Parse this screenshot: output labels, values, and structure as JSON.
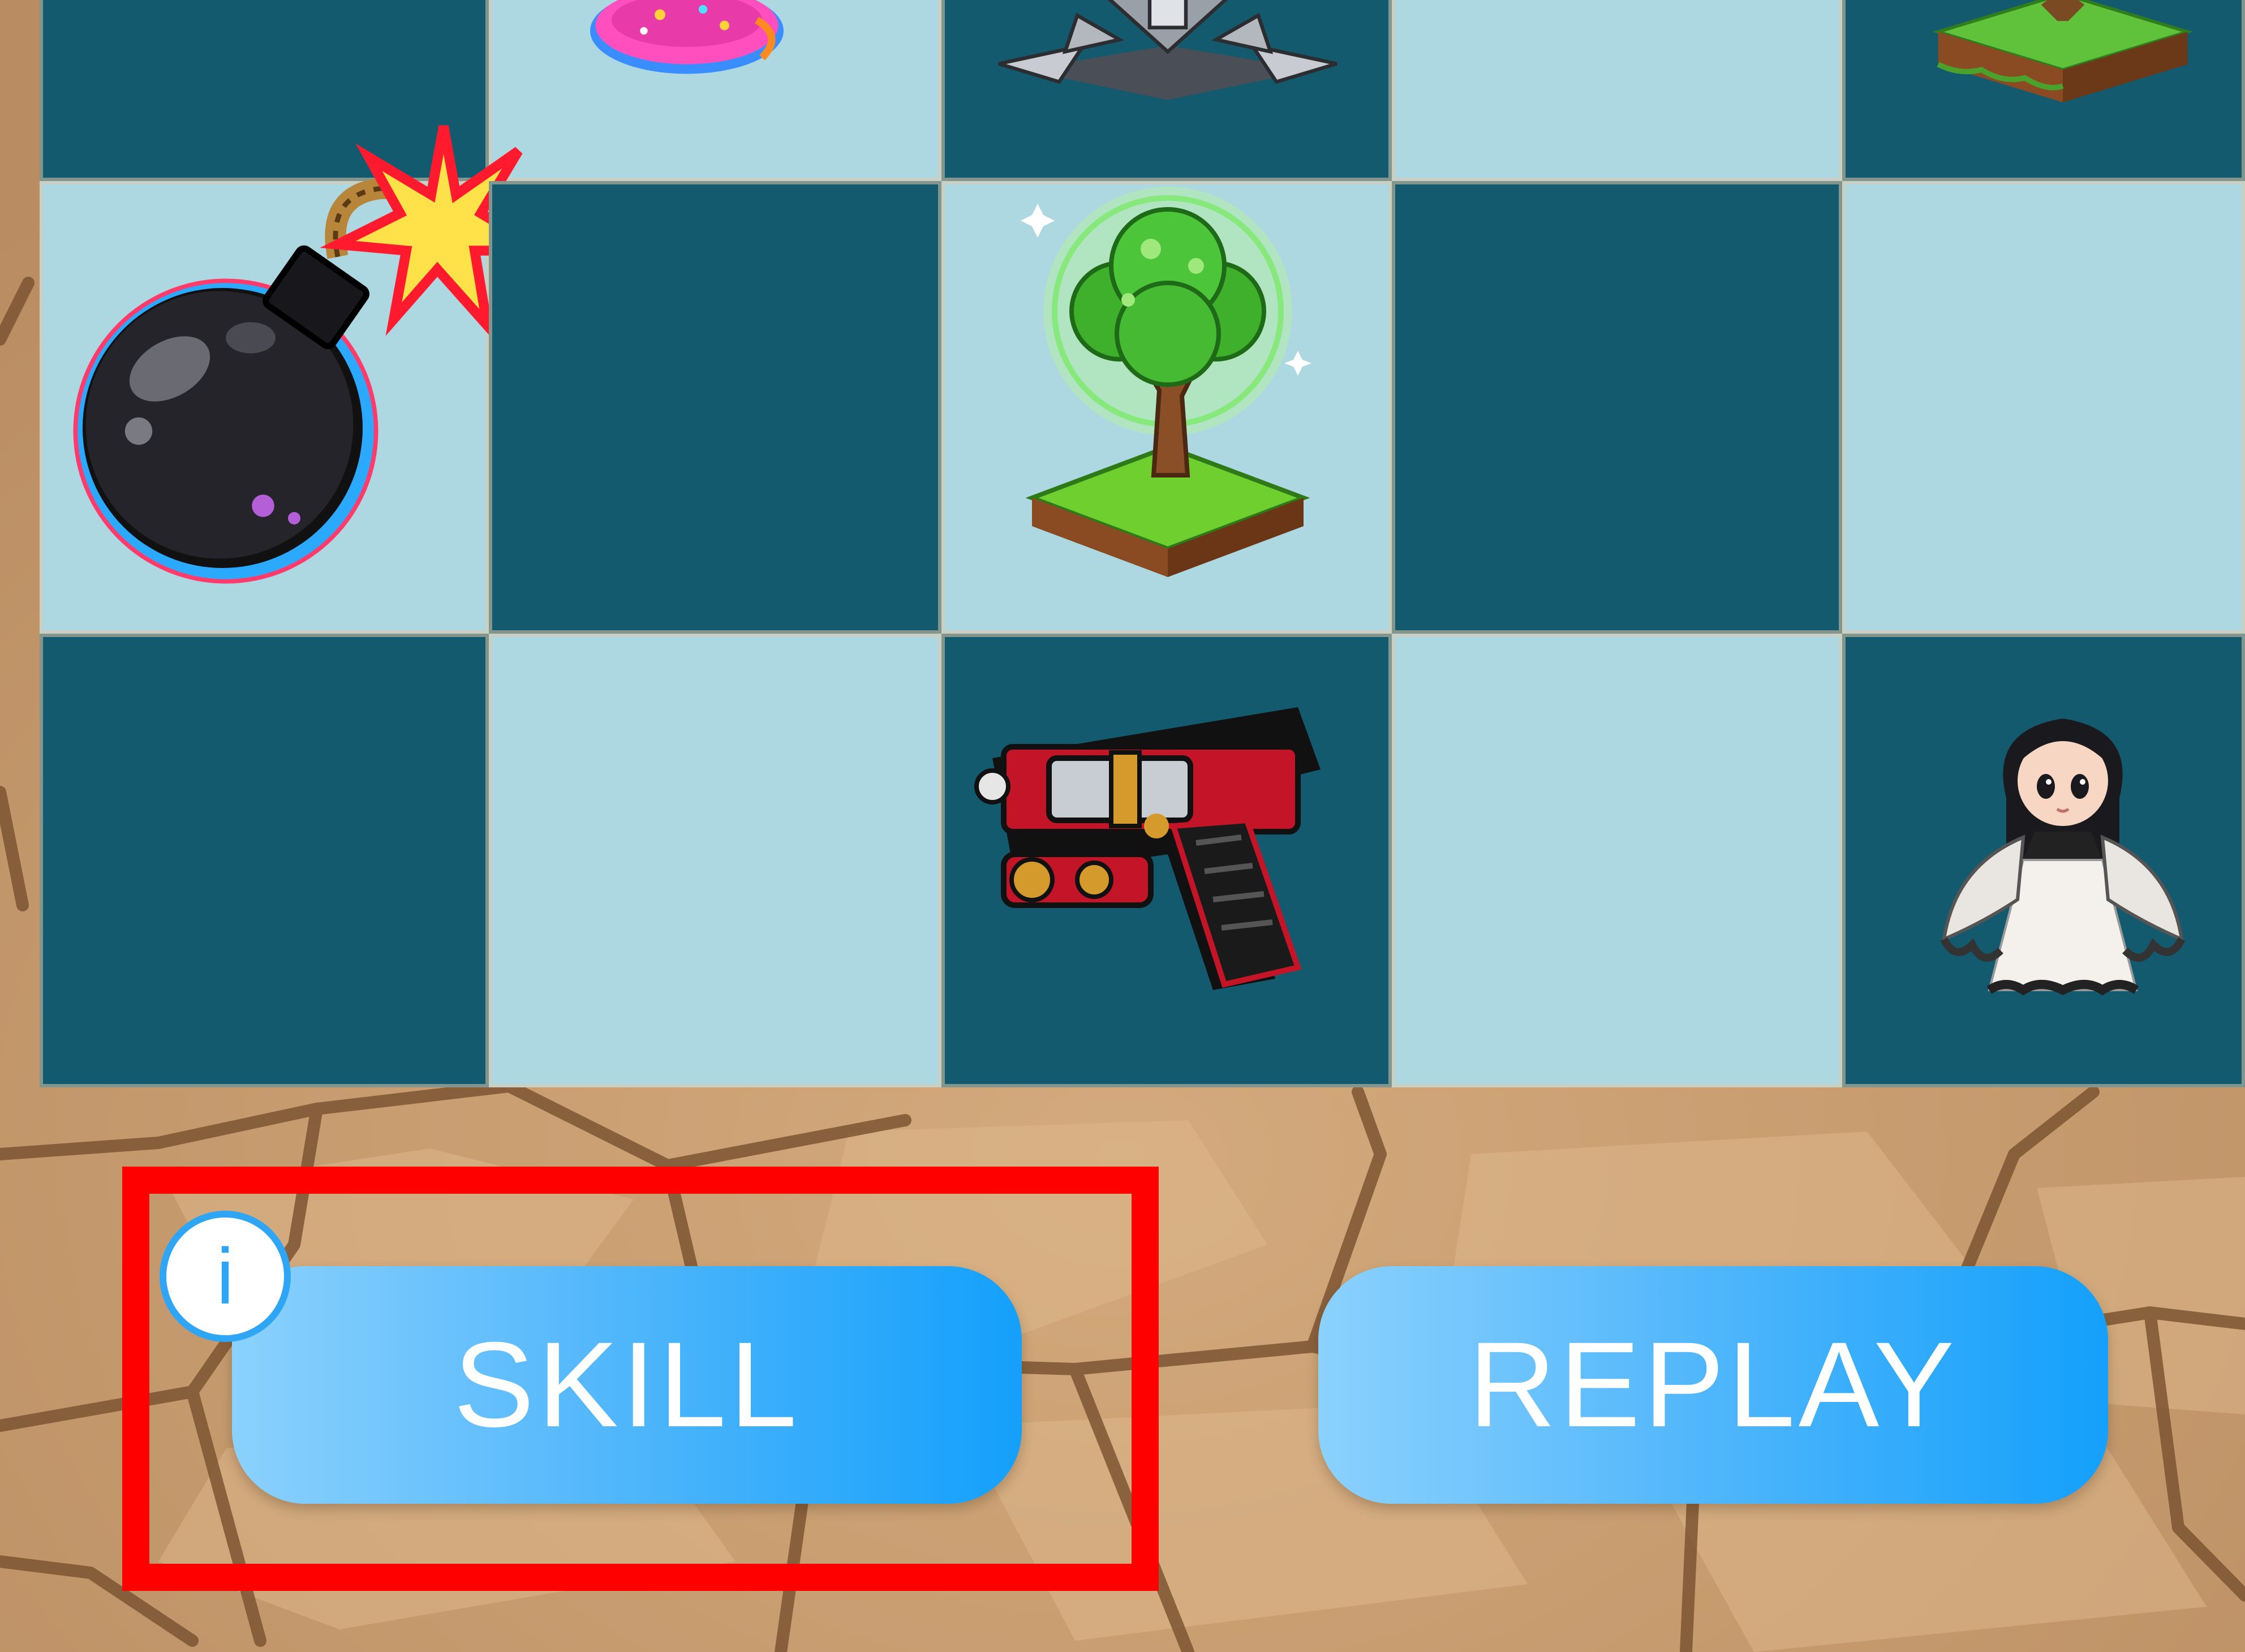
{
  "board": {
    "rows": [
      [
        {
          "color": "dark",
          "piece": null
        },
        {
          "color": "light",
          "piece": "donut-icon"
        },
        {
          "color": "dark",
          "piece": "spiked-fortress-icon"
        },
        {
          "color": "light",
          "piece": null
        },
        {
          "color": "dark",
          "piece": "grass-block-icon"
        }
      ],
      [
        {
          "color": "light",
          "piece": "bomb-icon"
        },
        {
          "color": "dark",
          "piece": null
        },
        {
          "color": "light",
          "piece": "tree-icon"
        },
        {
          "color": "dark",
          "piece": null
        },
        {
          "color": "light",
          "piece": null
        }
      ],
      [
        {
          "color": "dark",
          "piece": null
        },
        {
          "color": "light",
          "piece": null
        },
        {
          "color": "dark",
          "piece": "pistol-icon"
        },
        {
          "color": "light",
          "piece": null
        },
        {
          "color": "dark",
          "piece": "girl-character-icon"
        }
      ]
    ],
    "colors": {
      "dark": "#135a6e",
      "light": "#add8e2",
      "grout": "#dec8aa"
    }
  },
  "controls": {
    "skill_label": "SKILL",
    "replay_label": "REPLAY",
    "info_label": "i",
    "button_gradient": [
      "#8bd1fd",
      "#14a0fb"
    ]
  },
  "highlight": {
    "color": "#ff0000",
    "target": "skill-button"
  }
}
